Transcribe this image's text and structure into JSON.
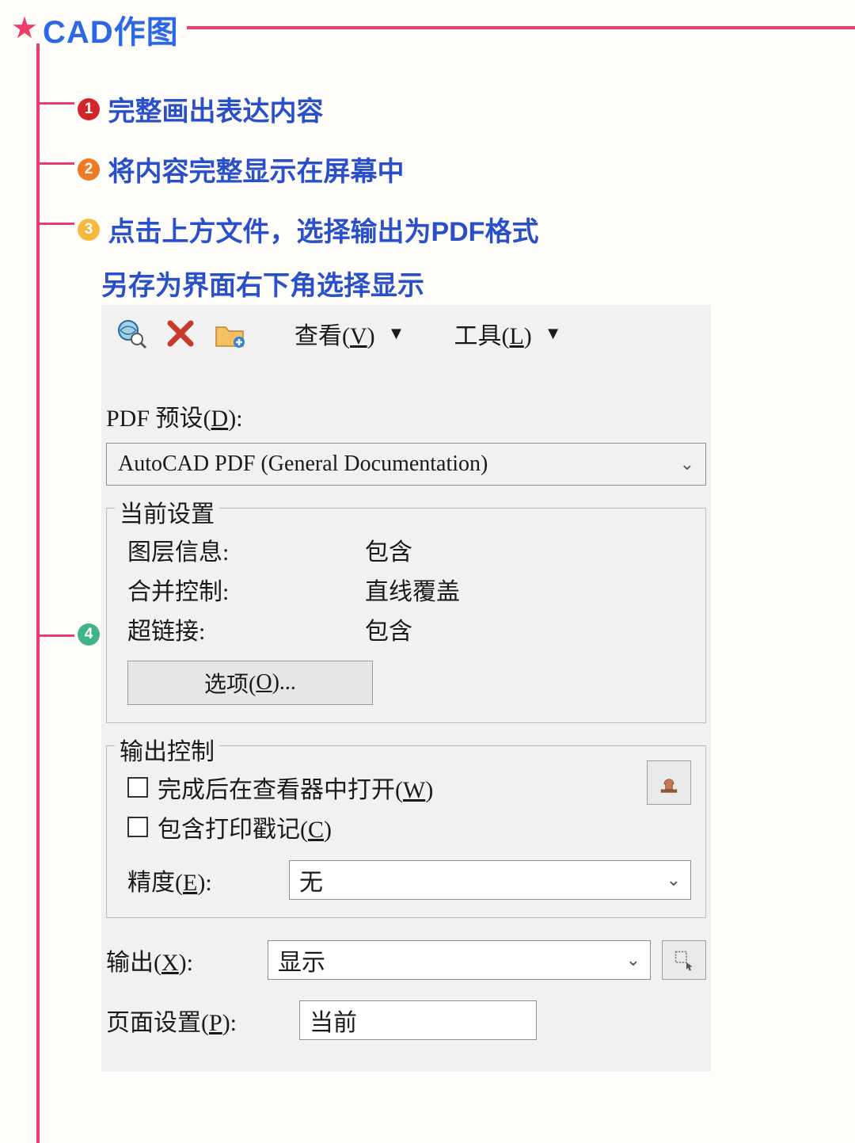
{
  "title": "CAD作图",
  "steps": {
    "s1": "完整画出表达内容",
    "s2": "将内容完整显示在屏幕中",
    "s3": "点击上方文件，选择输出为PDF格式",
    "s3b": "另存为界面右下角选择显示"
  },
  "toolbar": {
    "view_label_pre": "查看(",
    "view_hot": "V",
    "view_label_post": ")",
    "tools_label_pre": "工具(",
    "tools_hot": "L",
    "tools_label_post": ")"
  },
  "preset": {
    "label_pre": "PDF 预设(",
    "label_hot": "D",
    "label_post": "):",
    "value": "AutoCAD PDF (General Documentation)"
  },
  "current_settings": {
    "legend": "当前设置",
    "layer_k": "图层信息:",
    "layer_v": "包含",
    "merge_k": "合并控制:",
    "merge_v": "直线覆盖",
    "link_k": "超链接:",
    "link_v": "包含",
    "options_pre": "选项(",
    "options_hot": "O",
    "options_post": ")..."
  },
  "output_ctrl": {
    "legend": "输出控制",
    "open_pre": "完成后在查看器中打开(",
    "open_hot": "W",
    "open_post": ")",
    "stamp_pre": "包含打印戳记(",
    "stamp_hot": "C",
    "stamp_post": ")",
    "precision_pre": "精度(",
    "precision_hot": "E",
    "precision_post": "):",
    "precision_value": "无"
  },
  "output": {
    "label_pre": "输出(",
    "label_hot": "X",
    "label_post": "):",
    "value": "显示"
  },
  "page_setup": {
    "label_pre": "页面设置(",
    "label_hot": "P",
    "label_post": "):",
    "value": "当前"
  }
}
